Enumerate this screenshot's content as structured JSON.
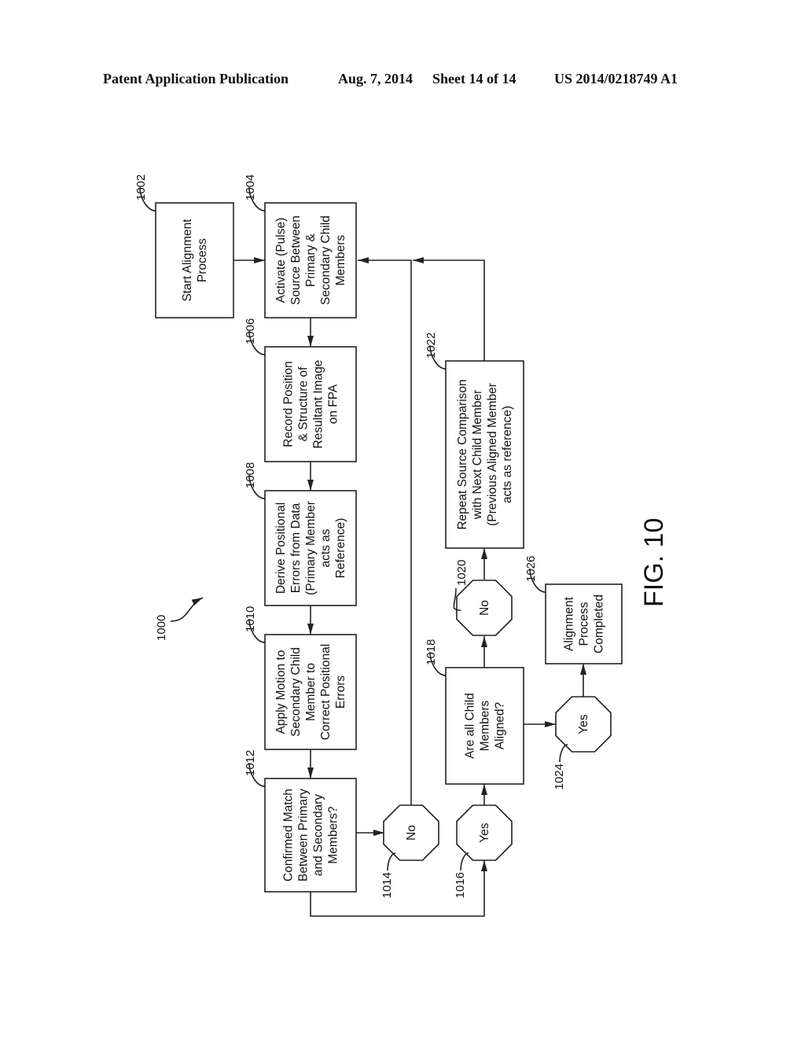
{
  "header": {
    "publication": "Patent Application Publication",
    "date": "Aug. 7, 2014",
    "sheet": "Sheet 14 of 14",
    "number": "US 2014/0218749 A1"
  },
  "figure": {
    "label": "FIG. 10",
    "ref": "1000"
  },
  "steps": [
    {
      "ref": "1002",
      "lines": [
        "Start Alignment",
        "Process"
      ]
    },
    {
      "ref": "1004",
      "lines": [
        "Activate (Pulse)",
        "Source Between",
        "Primary &",
        "Secondary Child",
        "Members"
      ]
    },
    {
      "ref": "1006",
      "lines": [
        "Record Position",
        "& Structure of",
        "Resultant Image",
        "on FPA"
      ]
    },
    {
      "ref": "1008",
      "lines": [
        "Derive Positional",
        "Errors from Data",
        "(Primary Member",
        "acts as",
        "Reference)"
      ]
    },
    {
      "ref": "1010",
      "lines": [
        "Apply Motion to",
        "Secondary Child",
        "Member to",
        "Correct Positional",
        "Errors"
      ]
    },
    {
      "ref": "1012",
      "lines": [
        "Confirmed Match",
        "Between Primary",
        "and Secondary",
        "Members?"
      ]
    },
    {
      "ref": "1018",
      "lines": [
        "Are all Child",
        "Members",
        "Aligned?"
      ]
    },
    {
      "ref": "1022",
      "lines": [
        "Repeat Source Comparison",
        "with Next Child Member",
        "(Previous Aligned Member",
        "acts as reference)"
      ]
    },
    {
      "ref": "1026",
      "lines": [
        "Alignment",
        "Process",
        "Completed"
      ]
    }
  ],
  "decisions": [
    {
      "ref": "1014",
      "label": "No"
    },
    {
      "ref": "1016",
      "label": "Yes"
    },
    {
      "ref": "1020",
      "label": "No"
    },
    {
      "ref": "1024",
      "label": "Yes"
    }
  ]
}
